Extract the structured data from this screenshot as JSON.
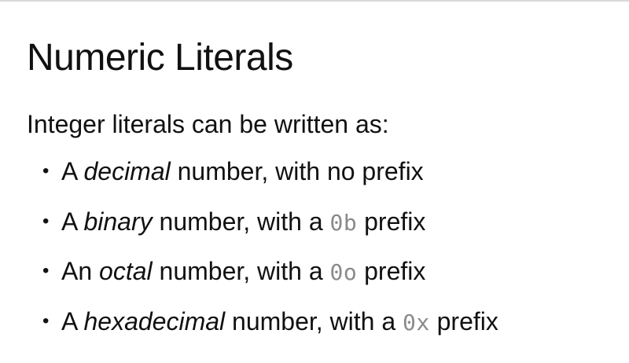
{
  "slide": {
    "title": "Numeric Literals",
    "intro": "Integer literals can be written as:",
    "items": [
      {
        "prefix_word": "A",
        "term": "decimal",
        "rest": "number, with no prefix",
        "code": "",
        "suffix": ""
      },
      {
        "prefix_word": "A",
        "term": "binary",
        "rest": "number, with a",
        "code": "0b",
        "suffix": "prefix"
      },
      {
        "prefix_word": "An",
        "term": "octal",
        "rest": "number, with a",
        "code": "0o",
        "suffix": "prefix"
      },
      {
        "prefix_word": "A",
        "term": "hexadecimal",
        "rest": "number, with a",
        "code": "0x",
        "suffix": "prefix"
      }
    ],
    "colors": {
      "text": "#111111",
      "code": "#8a8a8a",
      "rule": "#d9d9d9"
    }
  }
}
